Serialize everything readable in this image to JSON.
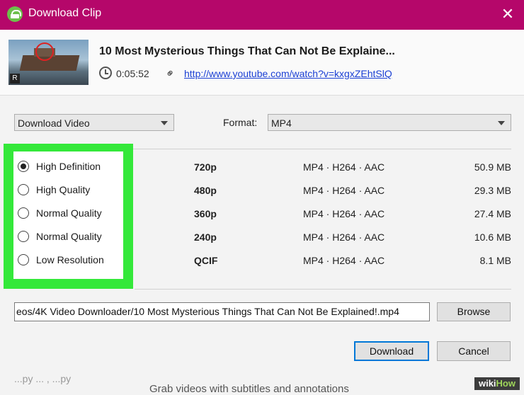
{
  "window": {
    "title": "Download Clip",
    "close_glyph": "✕",
    "accent_color": "#b5076a"
  },
  "video": {
    "title": "10 Most Mysterious Things That Can Not Be Explaine...",
    "duration": "0:05:52",
    "url": "http://www.youtube.com/watch?v=kxgxZEhtSlQ",
    "thumbnail_badge": "R"
  },
  "options": {
    "mode_select": "Download Video",
    "format_label": "Format:",
    "format_select": "MP4"
  },
  "quality_options": [
    {
      "label": "High Definition",
      "resolution": "720p",
      "codec": "MP4 · H264 · AAC",
      "size": "50.9 MB",
      "selected": true
    },
    {
      "label": "High Quality",
      "resolution": "480p",
      "codec": "MP4 · H264 · AAC",
      "size": "29.3 MB",
      "selected": false
    },
    {
      "label": "Normal Quality",
      "resolution": "360p",
      "codec": "MP4 · H264 · AAC",
      "size": "27.4 MB",
      "selected": false
    },
    {
      "label": "Normal Quality",
      "resolution": "240p",
      "codec": "MP4 · H264 · AAC",
      "size": "10.6 MB",
      "selected": false
    },
    {
      "label": "Low Resolution",
      "resolution": "QCIF",
      "codec": "MP4 · H264 · AAC",
      "size": "8.1 MB",
      "selected": false
    }
  ],
  "output": {
    "path": "eos/4K Video Downloader/10 Most Mysterious Things That Can Not Be Explained!.mp4",
    "browse_label": "Browse"
  },
  "actions": {
    "download_label": "Download",
    "cancel_label": "Cancel"
  },
  "background": {
    "faded_text": "...py ... , ...py",
    "footer_text": "Grab videos with subtitles and annotations"
  },
  "watermark": {
    "wiki": "wiki",
    "how": "How"
  },
  "highlight_color": "#34e83a"
}
